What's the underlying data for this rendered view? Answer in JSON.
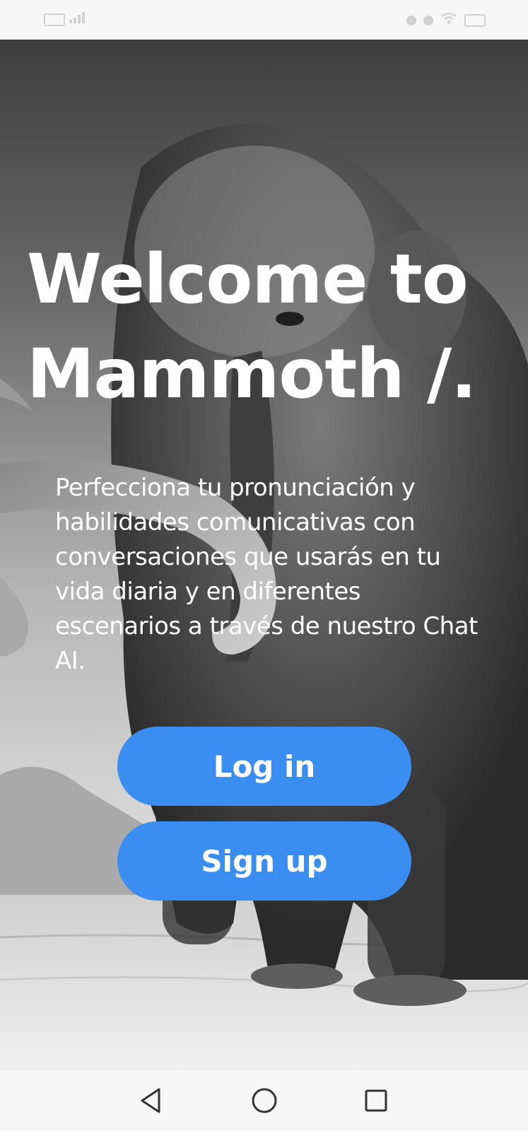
{
  "status_bar": {
    "left_icons": [
      "sim-icon",
      "signal-icon"
    ],
    "right_icons": [
      "alarm-icon",
      "location-icon",
      "wifi-icon",
      "battery-icon"
    ]
  },
  "hero": {
    "background": "black-and-white photo of a woolly mammoth on snowy ground",
    "headline_line1": "Welcome to",
    "headline_line2": "Mammoth /.",
    "intro": "Perfecciona tu pronunciación y habilidades comunicativas con conversaciones que usarás en tu vida diaria y en diferentes escenarios a través de nuestro Chat AI."
  },
  "actions": {
    "login_label": "Log in",
    "signup_label": "Sign up"
  },
  "nav_bar": {
    "back": "back-icon",
    "home": "home-icon",
    "recents": "recents-icon"
  },
  "colors": {
    "primary_button": "#3b8ef1",
    "text_on_photo": "#ffffff",
    "system_bar": "#f7f7f7"
  }
}
